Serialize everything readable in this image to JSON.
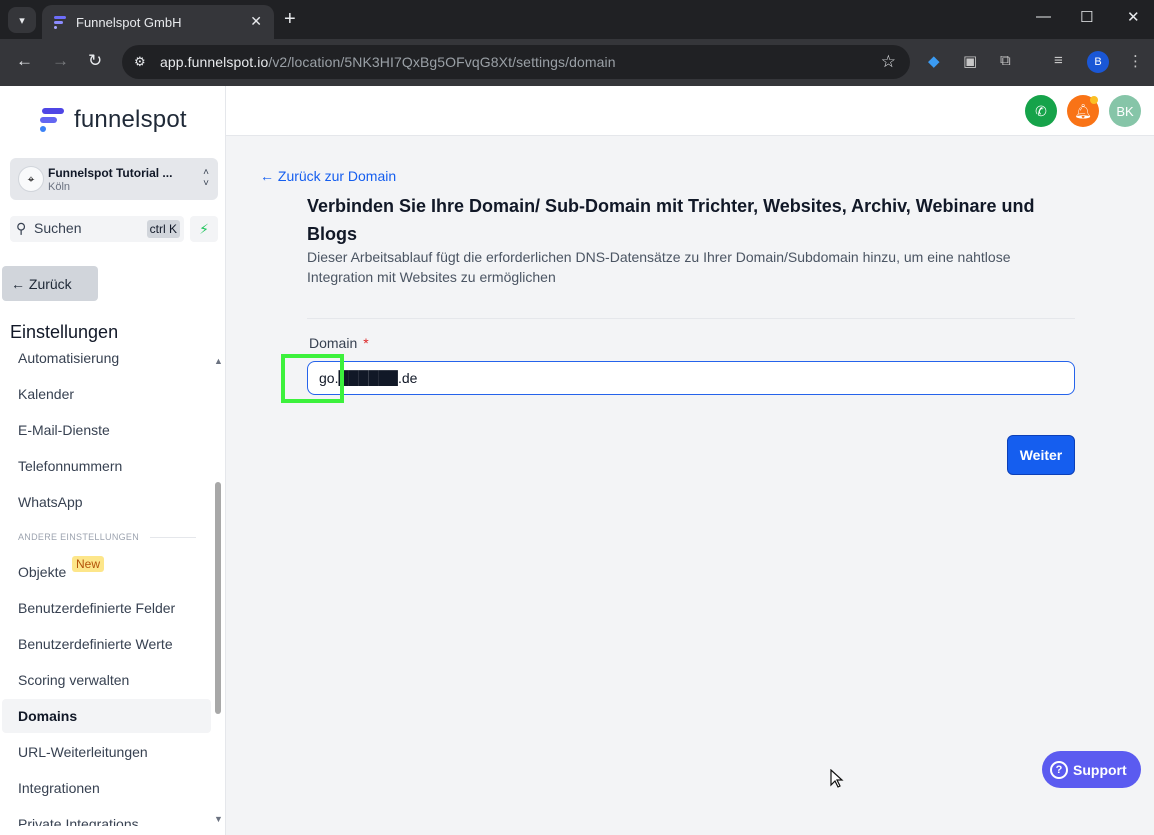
{
  "browser": {
    "tab_title": "Funnelspot GmbH",
    "tab_close": "✕",
    "new_tab": "+",
    "url_host": "app.funnelspot.io",
    "url_path": "/v2/location/5NK3HI7QxBg5OFvqG8Xt/settings/domain",
    "profile_initial": "B",
    "window_minimize": "—",
    "window_maximize": "☐",
    "window_close": "✕"
  },
  "sidebar": {
    "logo_text": "funnelspot",
    "location_name": "Funnelspot Tutorial ...",
    "location_city": "Köln",
    "search_label": "Suchen",
    "search_shortcut": "ctrl K",
    "back_label": "← Zurück",
    "settings_title": "Einstellungen",
    "items": [
      {
        "label": "Automatisierung"
      },
      {
        "label": "Kalender"
      },
      {
        "label": "E-Mail-Dienste"
      },
      {
        "label": "Telefonnummern"
      },
      {
        "label": "WhatsApp"
      },
      {
        "label": "Objekte"
      },
      {
        "label": "Benutzerdefinierte Felder"
      },
      {
        "label": "Benutzerdefinierte Werte"
      },
      {
        "label": "Scoring verwalten"
      },
      {
        "label": "Domains"
      },
      {
        "label": "URL-Weiterleitungen"
      },
      {
        "label": "Integrationen"
      },
      {
        "label": "Private Integrations"
      }
    ],
    "section_label": "ANDERE EINSTELLUNGEN",
    "new_badge": "New",
    "active_item": "Domains"
  },
  "topbar": {
    "avatar_initials": "BK"
  },
  "main": {
    "back_link": "← Zurück zur Domain",
    "title": "Verbinden Sie Ihre Domain/ Sub-Domain mit Trichter, Websites, Archiv, Webinare und Blogs",
    "description": "Dieser Arbeitsablauf fügt die erforderlichen DNS-Datensätze zu Ihrer Domain/Subdomain hinzu, um eine nahtlose Integration mit Websites zu ermöglichen",
    "domain_label": "Domain",
    "required_mark": "*",
    "domain_value": "go.██████.de",
    "next_button": "Weiter"
  },
  "support": {
    "label": "Support",
    "icon_glyph": "?"
  },
  "colors": {
    "accent": "#155eef",
    "highlight": "#3cf13c",
    "support": "#5b5bf0"
  }
}
